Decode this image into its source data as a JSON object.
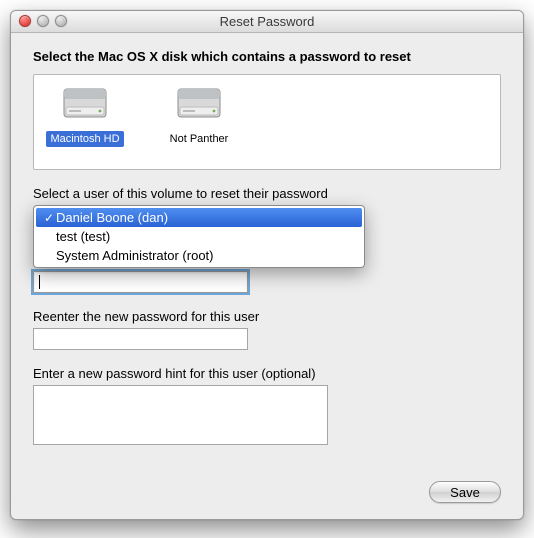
{
  "window": {
    "title": "Reset Password"
  },
  "heading": "Select the Mac OS X disk which contains a password to reset",
  "disks": [
    {
      "label": "Macintosh HD",
      "selected": true
    },
    {
      "label": "Not Panther",
      "selected": false
    }
  ],
  "select_user_label": "Select a user of this volume to reset their password",
  "user_menu": {
    "items": [
      {
        "label": "Daniel Boone (dan)",
        "checked": true,
        "highlighted": true
      },
      {
        "label": "test (test)",
        "checked": false,
        "highlighted": false
      },
      {
        "label": "System Administrator (root)",
        "checked": false,
        "highlighted": false
      }
    ]
  },
  "new_password": {
    "value": ""
  },
  "reenter_label": "Reenter the new password for this user",
  "reenter_value": "",
  "hint_label": "Enter a new password hint for this user (optional)",
  "hint_value": "",
  "save_button": "Save"
}
